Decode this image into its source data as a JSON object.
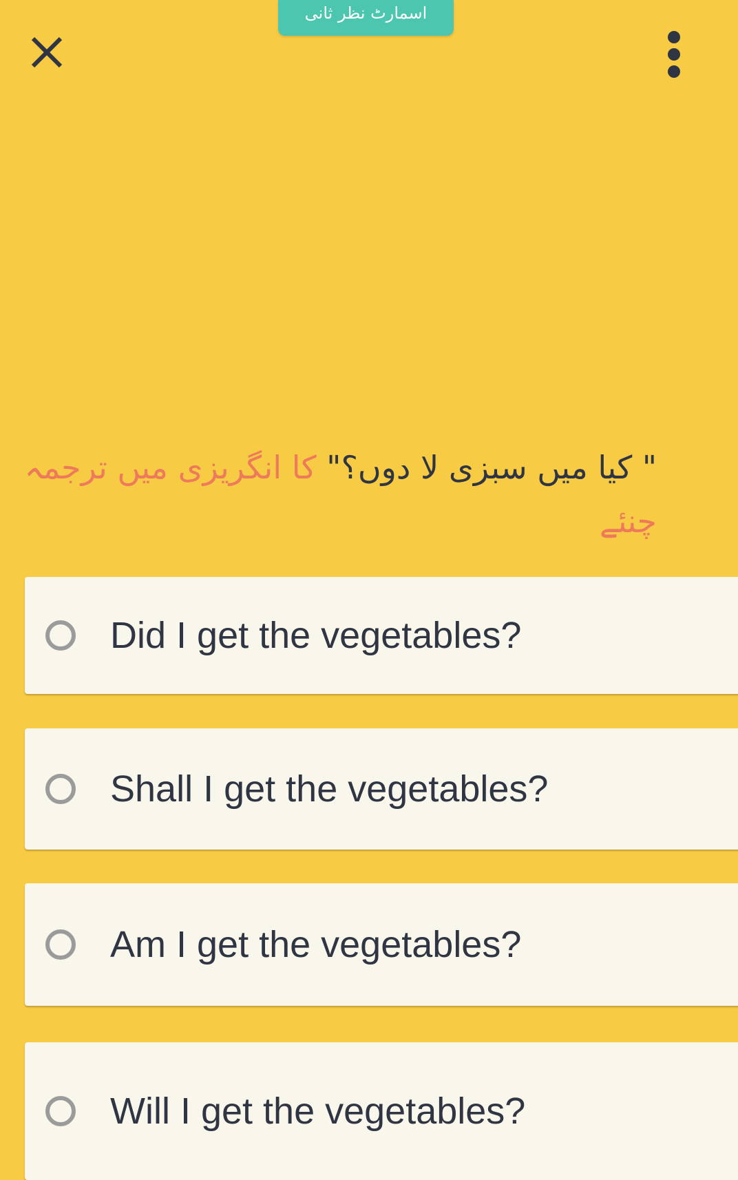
{
  "header": {
    "badge_label": "اسمارٹ نظر ثانی",
    "close_icon": "close-icon",
    "menu_icon": "more-vertical-icon"
  },
  "question": {
    "quote_part": "\" کیا میں سبزی لا دوں؟\"",
    "instruction_part": " کا انگریزی میں ترجمہ چنئے"
  },
  "options": [
    {
      "label": "Did I get the vegetables?"
    },
    {
      "label": "Shall I get the vegetables?"
    },
    {
      "label": "Am I get the vegetables?"
    },
    {
      "label": "Will I get the vegetables?"
    }
  ],
  "colors": {
    "background": "#F8CB44",
    "badge": "#4DC6B0",
    "question_highlight": "#EC7A5B",
    "option_card": "#F9F6EC"
  }
}
